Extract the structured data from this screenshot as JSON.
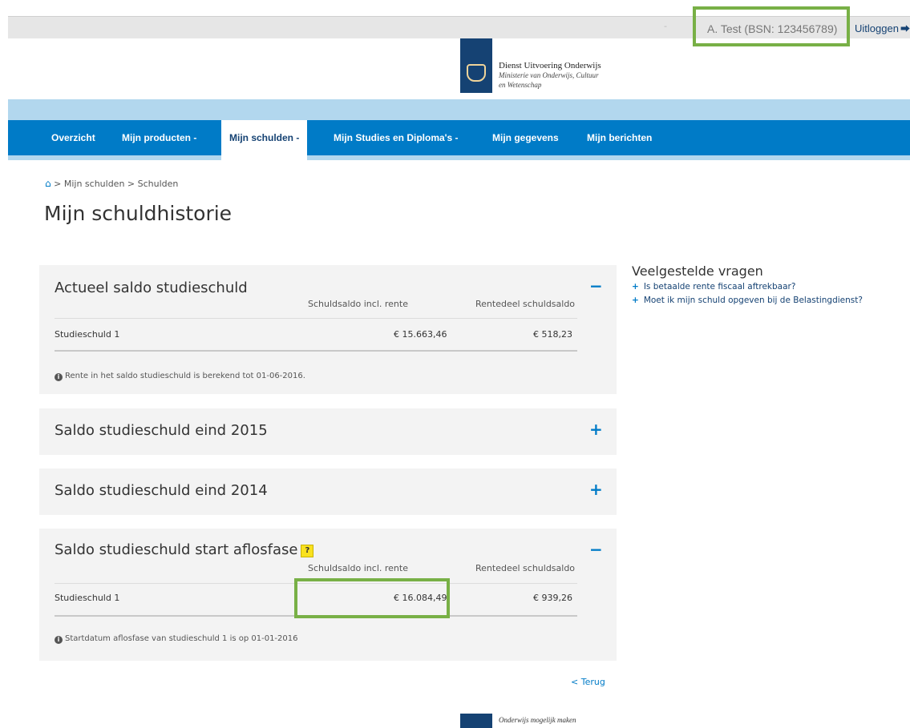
{
  "header": {
    "separator": "-",
    "user": "A. Test (BSN: 123456789)",
    "logout_label": "Uitloggen",
    "logout_icon": "sign-out-icon",
    "org_name": "Dienst Uitvoering Onderwijs",
    "ministry": "Ministerie van Onderwijs, Cultuur en Wetenschap"
  },
  "nav": {
    "items": [
      {
        "label": "Overzicht"
      },
      {
        "label": "Mijn producten -"
      },
      {
        "label": "Mijn schulden -"
      },
      {
        "label": "Mijn Studies en Diploma's -"
      },
      {
        "label": "Mijn gegevens"
      },
      {
        "label": "Mijn berichten"
      }
    ],
    "active_index": 2
  },
  "breadcrumb": {
    "home_icon": "home-icon",
    "text": "> Mijn schulden > Schulden"
  },
  "page_title": "Mijn schuldhistorie",
  "panels": [
    {
      "title": "Actueel saldo studieschuld",
      "toggle": "−",
      "columns": [
        "Schuldsaldo incl. rente",
        "Rentedeel schuldsaldo"
      ],
      "rows": [
        {
          "name": "Studieschuld 1",
          "saldo": "€ 15.663,46",
          "rente": "€ 518,23"
        }
      ],
      "note": "Rente in het saldo studieschuld is berekend tot 01-06-2016."
    },
    {
      "title": "Saldo studieschuld eind 2015",
      "toggle": "+"
    },
    {
      "title": "Saldo studieschuld eind 2014",
      "toggle": "+"
    },
    {
      "title": "Saldo studieschuld start aflosfase",
      "help": "?",
      "toggle": "−",
      "columns": [
        "Schuldsaldo incl. rente",
        "Rentedeel schuldsaldo"
      ],
      "rows": [
        {
          "name": "Studieschuld 1",
          "saldo": "€ 16.084,49",
          "rente": "€ 939,26"
        }
      ],
      "note": "Startdatum aflosfase van studieschuld 1 is op 01-01-2016"
    }
  ],
  "faq": {
    "title": "Veelgestelde vragen",
    "items": [
      {
        "label": "Is betaalde rente fiscaal aftrekbaar?"
      },
      {
        "label": "Moet ik mijn schuld opgeven bij de Belastingdienst?"
      }
    ]
  },
  "back_link": "< Terug",
  "footer": {
    "tagline": "Onderwijs mogelijk maken"
  },
  "colors": {
    "primary": "#007bc7",
    "dark_blue": "#154273",
    "light_band": "#b2d7ee",
    "highlight": "#78b046",
    "panel_bg": "#f3f3f3"
  }
}
